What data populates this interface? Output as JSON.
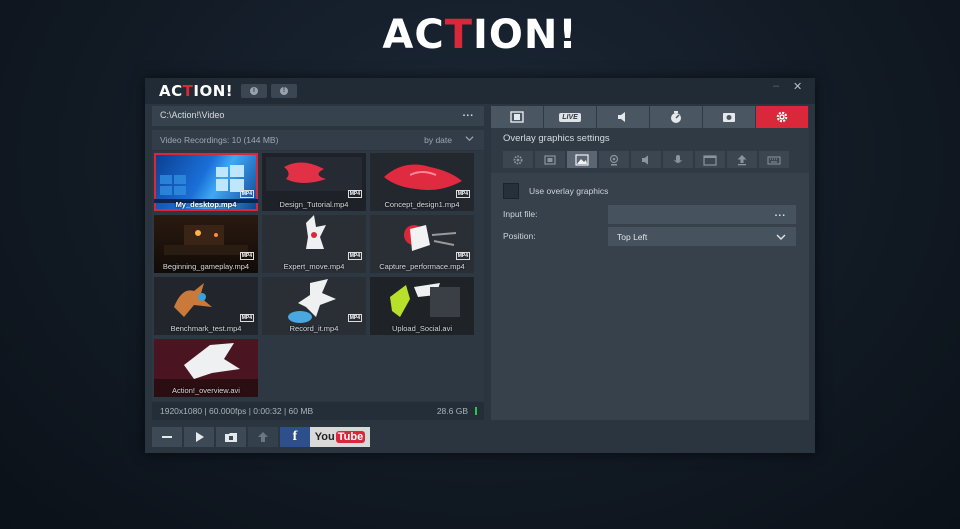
{
  "brand": {
    "logo_pre": "AC",
    "logo_accent": "T",
    "logo_post": "ION!",
    "accent_color": "#d8283a"
  },
  "window": {
    "title_pre": "AC",
    "title_accent": "T",
    "title_post": "ION!",
    "help_icon": "info-icon",
    "info_icon": "exclamation-icon",
    "minimize": "–",
    "close": "✕"
  },
  "browser": {
    "path": "C:\\Action!\\Video",
    "path_menu": "...",
    "recordings_label": "Video Recordings: 10 (144 MB)",
    "sort_label": "by date",
    "files": [
      {
        "name": "My_desktop.mp4",
        "badge": "MP4",
        "selected": true
      },
      {
        "name": "Design_Tutorial.mp4",
        "badge": "MP4",
        "selected": false
      },
      {
        "name": "Concept_design1.mp4",
        "badge": "MP4",
        "selected": false
      },
      {
        "name": "Beginning_gameplay.mp4",
        "badge": "MP4",
        "selected": false
      },
      {
        "name": "Expert_move.mp4",
        "badge": "MP4",
        "selected": false
      },
      {
        "name": "Capture_performace.mp4",
        "badge": "MP4",
        "selected": false
      },
      {
        "name": "Benchmark_test.mp4",
        "badge": "MP4",
        "selected": false
      },
      {
        "name": "Record_it.mp4",
        "badge": "MP4",
        "selected": false
      },
      {
        "name": "Upload_Social.avi",
        "badge": "",
        "selected": false
      },
      {
        "name": "Action!_overview.avi",
        "badge": "",
        "selected": false
      }
    ],
    "status": "1920x1080 | 60.000fps | 0:00:32 | 60 MB",
    "disk_free": "28.6 GB"
  },
  "toolbar": {
    "buttons": [
      "minus-icon",
      "play-icon",
      "folder-icon",
      "upload-icon"
    ],
    "facebook": "f",
    "youtube_you": "You",
    "youtube_tube": "Tube"
  },
  "settings": {
    "tabs": [
      "video-icon",
      "live-icon",
      "audio-icon",
      "benchmark-icon",
      "screenshot-icon",
      "settings-icon"
    ],
    "live_label": "LIVE",
    "active_tab": 5,
    "section_title": "Overlay graphics settings",
    "subtabs": [
      "gear-icon",
      "film-icon",
      "image-icon",
      "webcam-icon",
      "speaker-icon",
      "microphone-icon",
      "window-icon",
      "upload-icon",
      "keyboard-icon"
    ],
    "active_subtab": 2,
    "use_overlay_label": "Use overlay graphics",
    "use_overlay_checked": false,
    "input_file_label": "Input file:",
    "input_file_value": "",
    "input_file_menu": "...",
    "position_label": "Position:",
    "position_value": "Top Left"
  }
}
